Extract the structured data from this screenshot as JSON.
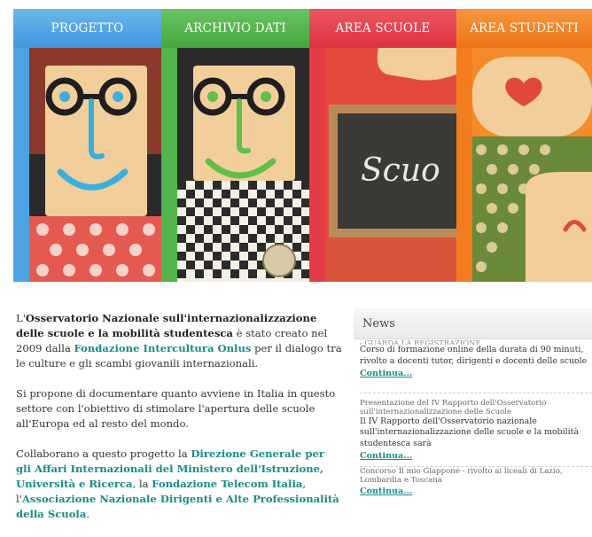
{
  "nav": {
    "tabs": [
      {
        "label": "PROGETTO"
      },
      {
        "label": "ARCHIVIO DATI"
      },
      {
        "label": "AREA SCUOLE"
      },
      {
        "label": "AREA STUDENTI"
      }
    ],
    "chalkboard_text": "Scuo"
  },
  "intro": {
    "p1": {
      "pre": "L'",
      "bold": "Osservatorio Nazionale sull'internazionalizzazione delle scuole e la mobilità studentesca",
      "mid": " è stato creato nel 2009 dalla ",
      "link": "Fondazione Intercultura Onlus",
      "post": " per il dialogo tra le culture e gli scambi giovanili internazionali."
    },
    "p2": "Si propone di documentare quanto avviene in Italia in questo settore con l'obiettivo di stimolare l'apertura delle scuole all'Europa ed al resto del mondo.",
    "p3": {
      "pre": "Collaborano a questo progetto la ",
      "link1": "Direzione Generale per gli Affari Internazionali del Ministero dell'Istruzione, Università e Ricerca",
      "mid1": ", la ",
      "link2": "Fondazione Telecom Italia",
      "mid2": ", l'",
      "link3": "Associazione Nazionale Dirigenti e Alte Professionalità della Scuola",
      "post": "."
    }
  },
  "news": {
    "title": "News",
    "cut_line": "- GUARDA LA REGISTRAZIONE",
    "items": [
      {
        "small": "",
        "text": "Corso di formazione online della durata di 90 minuti, rivolto a docenti tutor, dirigenti e docenti delle scuole",
        "more": "Continua..."
      },
      {
        "small": "Presentazione del IV Rapporto dell'Osservatorio sull'internazionalizzazione delle Scuole",
        "text": "Il IV Rapporto dell'Osservatorio nazionale sull'internazionalizzazione delle scuole e la mobilità studentesca sarà",
        "more": "Continua..."
      },
      {
        "small": "Concorso Il mio Giappone - rivolto ai liceali di Lazio, Lombardia e Toscana",
        "text": "",
        "more": "Continua..."
      }
    ]
  },
  "colors": {
    "tab_blue": "#4ba3e3",
    "tab_green": "#52b44b",
    "tab_red": "#e33c46",
    "tab_orange": "#f27d1e",
    "link_teal": "#1a8a8a"
  }
}
